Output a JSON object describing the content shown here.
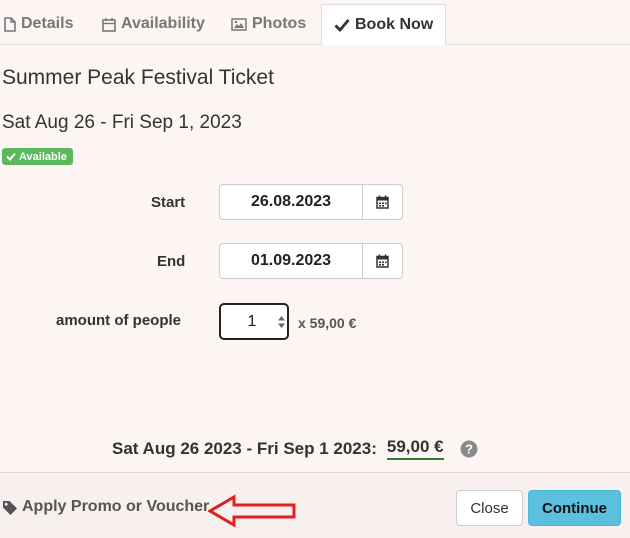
{
  "tabs": [
    {
      "label": "Details",
      "icon": "file-icon"
    },
    {
      "label": "Availability",
      "icon": "calendar-icon"
    },
    {
      "label": "Photos",
      "icon": "image-icon"
    },
    {
      "label": "Book Now",
      "icon": "check-icon",
      "active": true
    }
  ],
  "event": {
    "title": "Summer Peak Festival Ticket",
    "dates": "Sat Aug 26 - Fri Sep 1, 2023",
    "status": "Available",
    "status_color": "#5cb85c"
  },
  "form": {
    "start_label": "Start",
    "start_value": "26.08.2023",
    "end_label": "End",
    "end_value": "01.09.2023",
    "people_label": "amount of people",
    "people_value": "1",
    "price_per_person": "x 59,00 €"
  },
  "summary": {
    "range": "Sat Aug 26 2023 - Fri Sep 1 2023:",
    "total": "59,00 €",
    "total_underline_color": "#2e7d32"
  },
  "footer": {
    "promo_label": "Apply Promo or Voucher",
    "close_label": "Close",
    "continue_label": "Continue",
    "continue_color": "#5bc0de",
    "annotation_arrow_color": "#e02020"
  }
}
